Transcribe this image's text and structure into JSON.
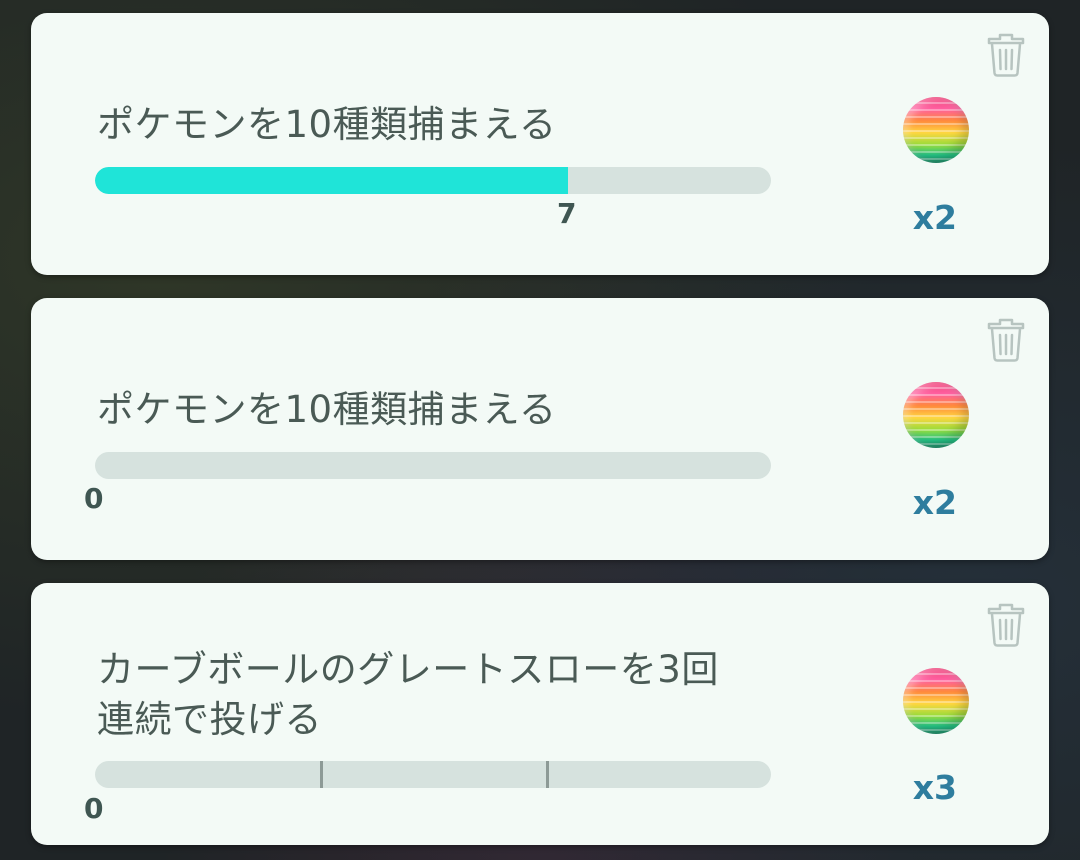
{
  "tasks": [
    {
      "title": "ポケモンを10種類捕まえる",
      "progress_label": "7",
      "progress_fraction": 0.7,
      "segments": 1,
      "reward_label": "x2",
      "reward_icon": "rainbow-orb-icon"
    },
    {
      "title": "ポケモンを10種類捕まえる",
      "progress_label": "0",
      "progress_fraction": 0,
      "segments": 1,
      "reward_label": "x2",
      "reward_icon": "rainbow-orb-icon"
    },
    {
      "title_line1": "カーブボールのグレートスローを3回",
      "title_line2": "連続で投げる",
      "progress_label": "0",
      "progress_fraction": 0,
      "segments": 3,
      "reward_label": "x3",
      "reward_icon": "rainbow-orb-icon"
    }
  ],
  "icons": {
    "delete": "trash-icon"
  },
  "colors": {
    "card_bg": "#f3faf6",
    "progress_fill": "#1fe4d8",
    "progress_track": "#d6e2de",
    "reward_text": "#2e7d9e",
    "title_text": "#4a5a55"
  }
}
